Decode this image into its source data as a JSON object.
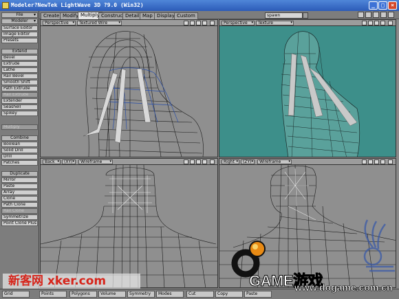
{
  "window": {
    "title": "Modeler?NewTek LightWave 3D ?9.0 (Win32)",
    "controls": [
      "_",
      "□",
      "×"
    ]
  },
  "tabs": [
    {
      "label": "Create",
      "active": false
    },
    {
      "label": "Modify",
      "active": false
    },
    {
      "label": "Multiply",
      "active": true
    },
    {
      "label": "Construct",
      "active": false
    },
    {
      "label": "Detail",
      "active": false
    },
    {
      "label": "Map",
      "active": false
    },
    {
      "label": "Display",
      "active": false
    },
    {
      "label": "Custom",
      "active": false
    }
  ],
  "spawn_field": "spawn",
  "sidebar": {
    "file": "File",
    "modeler": "Modeler",
    "items_top": [
      "Surface Editor",
      "Image Editor",
      "Presets"
    ],
    "extend_header": "Extend",
    "extend_items": [
      {
        "label": "Bevel",
        "dim": false
      },
      {
        "label": "Extrude",
        "dim": false
      },
      {
        "label": "Lathe",
        "dim": false
      },
      {
        "label": "Rail Bevel",
        "dim": false
      },
      {
        "label": "Smooth Shift",
        "dim": false
      },
      {
        "label": "Path Extrude",
        "dim": false
      },
      {
        "label": "Rail Extrude",
        "dim": true
      },
      {
        "label": "Extender",
        "dim": false
      },
      {
        "label": "Seashell",
        "dim": false
      },
      {
        "label": "Spikey",
        "dim": false
      },
      {
        "label": "Multiply",
        "dim": true
      }
    ],
    "combine_header": "Combine",
    "combine_items": [
      {
        "label": "Boolean",
        "dim": false
      },
      {
        "label": "Solid Drill",
        "dim": false
      },
      {
        "label": "Drill",
        "dim": false
      },
      {
        "label": "Patches",
        "dim": false
      }
    ],
    "duplicate_header": "Duplicate",
    "duplicate_items": [
      {
        "label": "Mirror",
        "dim": false
      },
      {
        "label": "Paste",
        "dim": false
      },
      {
        "label": "Array",
        "dim": false
      },
      {
        "label": "Clone",
        "dim": false
      },
      {
        "label": "Path Clone",
        "dim": false
      },
      {
        "label": "Rail Clone",
        "dim": true
      },
      {
        "label": "Symmetrize",
        "dim": false
      },
      {
        "label": "Point Clone Plus",
        "dim": false
      }
    ]
  },
  "viewports": {
    "top_left": {
      "view": "Perspective",
      "mode": "Textured Wire"
    },
    "top_right": {
      "view": "Perspective",
      "mode": "Texture"
    },
    "bottom_left": {
      "view": "Back",
      "axis": "(XY)",
      "mode": "Wireframe"
    },
    "bottom_right": {
      "view": "Right",
      "axis": "(ZY)",
      "mode": "Wireframe"
    }
  },
  "statusbar": {
    "items": [
      "Grid",
      "Points",
      "Polygons",
      "Volume",
      "Symmetry",
      "Modes",
      "Cut",
      "Copy",
      "Paste"
    ]
  },
  "watermark": {
    "left": "新客网 xker.com",
    "game_text": "GAME游戏",
    "url": "www.dogame.com.cn"
  },
  "colors": {
    "texture_viewport": "#3d8f8a",
    "title_blue": "#2c5bb8",
    "watermark_red": "#d6241a"
  }
}
